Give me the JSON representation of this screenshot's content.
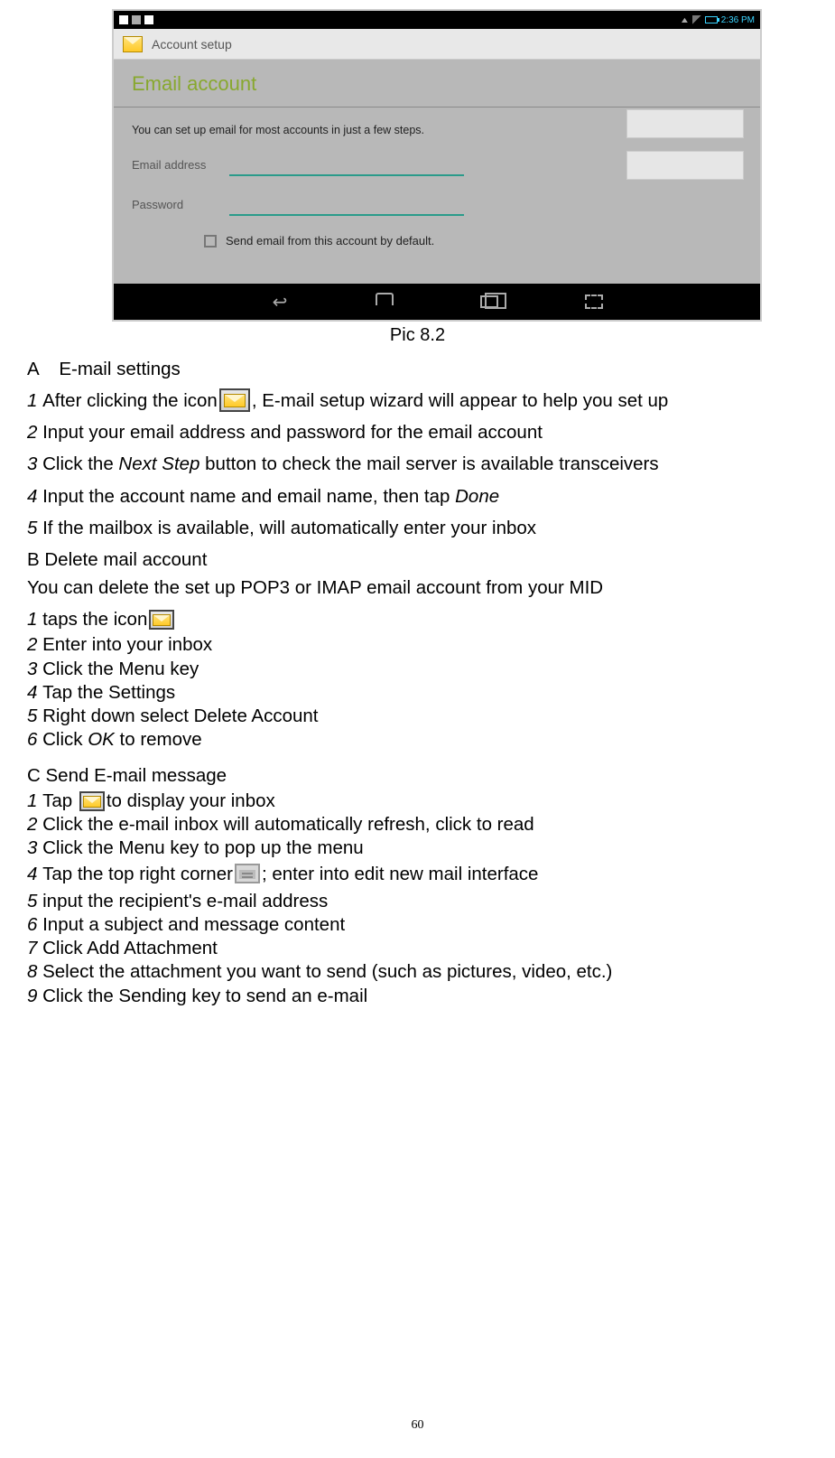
{
  "screenshot": {
    "statusbar": {
      "time": "2:36 PM"
    },
    "titlebar": "Account setup",
    "section_title": "Email account",
    "intro": "You can set up email for most accounts in just a few steps.",
    "fields": {
      "email_label": "Email address",
      "password_label": "Password"
    },
    "checkbox_label": "Send email from this account by default."
  },
  "caption": "Pic 8.2",
  "secA": {
    "heading": "A    E-mail settings",
    "i1_pre": "After clicking the icon",
    "i1_post": ", E-mail setup wizard will appear to help you set up",
    "i2": "Input your email address and password for the email account",
    "i3_pre": "Click the ",
    "i3_em": "Next Step",
    "i3_post": " button to check the mail server is available transceivers",
    "i4_pre": "Input the account name and email name, then tap ",
    "i4_em": "Done",
    "i5": "If the mailbox is available, will automatically enter your inbox"
  },
  "secB": {
    "heading": "B Delete mail account",
    "intro": "You can delete the set up POP3 or IMAP email account from your MID",
    "i1": "taps the icon",
    "i2": "Enter into your inbox",
    "i3": "Click the Menu key",
    "i4": "Tap the Settings",
    "i5": "Right down select Delete Account",
    "i6_pre": "Click ",
    "i6_em": "OK",
    "i6_post": " to remove"
  },
  "secC": {
    "heading": "C Send E-mail message",
    "i1_pre": "Tap ",
    "i1_post": "to display your inbox",
    "i2": "Click the e-mail inbox will automatically refresh, click to read",
    "i3": "Click the Menu key to pop up the menu",
    "i4_pre": "Tap the top right corner",
    "i4_post": "; enter into edit new mail interface",
    "i5": "input the recipient's e-mail address",
    "i6": "Input a subject and message content",
    "i7": "Click Add Attachment",
    "i8": "Select the attachment you want to send (such as pictures, video, etc.)",
    "i9": "Click the Sending key to send an e-mail"
  },
  "page_number": "60"
}
